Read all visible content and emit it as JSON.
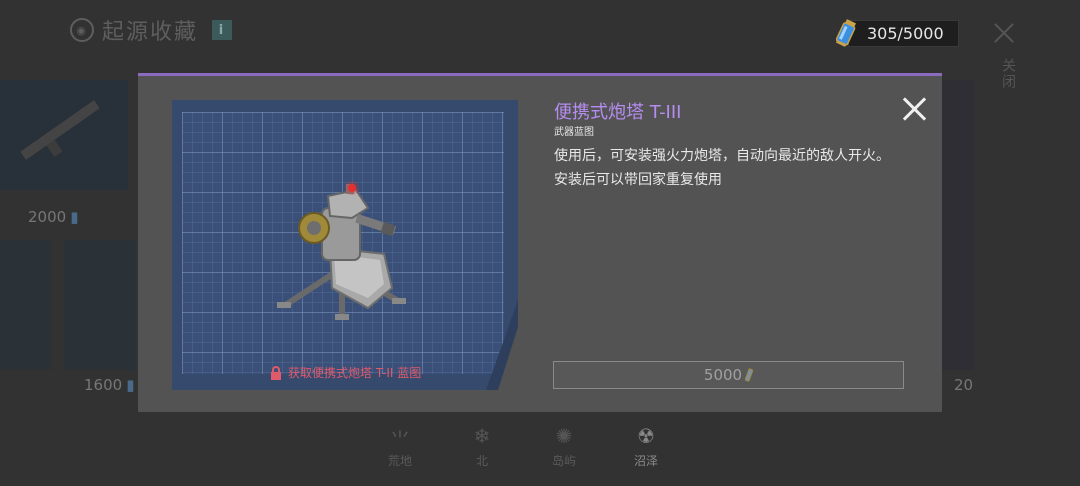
{
  "header": {
    "title": "起源收藏",
    "info_label": "i"
  },
  "currency": {
    "value": "305/5000"
  },
  "top_close": {
    "label": "关闭"
  },
  "background_cards": [
    {
      "price": "2000"
    },
    {
      "price": "1600"
    },
    {
      "price": "20"
    }
  ],
  "bottom_tabs": [
    {
      "label": "荒地",
      "icon": "grass-icon",
      "active": false
    },
    {
      "label": "北",
      "icon": "snowflake-icon",
      "active": false
    },
    {
      "label": "岛屿",
      "icon": "island-icon",
      "active": false
    },
    {
      "label": "沼泽",
      "icon": "radiation-icon",
      "active": true
    }
  ],
  "modal": {
    "item_name": "便携式炮塔 T-III",
    "item_type": "武器蓝图",
    "description": [
      "使用后，可安装强火力炮塔，自动向最近的敌人开火。",
      "安装后可以带回家重复使用"
    ],
    "requirement": "获取便携式炮塔 T-II 蓝图",
    "price": "5000"
  },
  "colors": {
    "accent": "#b58df0",
    "lock": "#e05a6a",
    "blueprint": "#364a6e"
  }
}
